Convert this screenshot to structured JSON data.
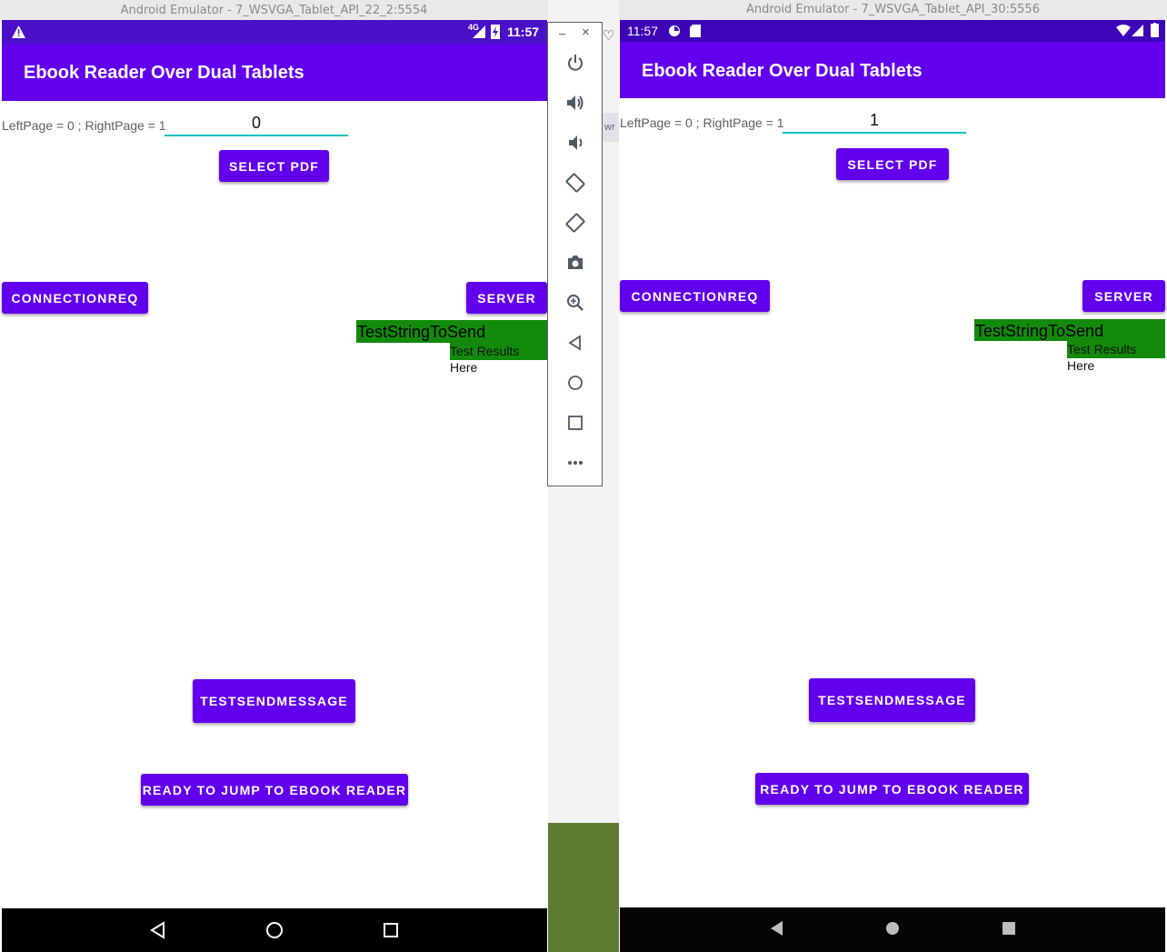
{
  "left_window": {
    "title": "Android Emulator - 7_WSVGA_Tablet_API_22_2:5554",
    "status_time": "11:57",
    "status_network": "4G",
    "app_title": "Ebook Reader Over Dual Tablets",
    "page_label": "LeftPage = 0 ; RightPage = 1",
    "page_input_value": "0",
    "select_pdf_label": "Select PDF",
    "connectionreq_label": "CONNECTIONREQ",
    "server_label": "SERVER",
    "test_string": "TestStringToSend",
    "test_results": "Test Results Here",
    "testsendmessage_label": "TESTSENDMESSAGE",
    "ready_label": "READY TO JUMP TO EBOOK READER"
  },
  "right_window": {
    "title": "Android Emulator - 7_WSVGA_Tablet_API_30:5556",
    "status_time": "11:57",
    "app_title": "Ebook Reader Over Dual Tablets",
    "page_label": "LeftPage = 0 ; RightPage = 1",
    "page_input_value": "1",
    "select_pdf_label": "Select PDF",
    "connectionreq_label": "CONNECTIONREQ",
    "server_label": "SERVER",
    "test_string": "TestStringToSend",
    "test_results": "Test Results Here",
    "testsendmessage_label": "TESTSENDMESSAGE",
    "ready_label": "READY TO JUMP TO EBOOK READER"
  },
  "toolbar": {
    "minimize": "–",
    "close": "×",
    "icons": [
      "power-icon",
      "volume-up-icon",
      "volume-down-icon",
      "rotate-left-icon",
      "rotate-right-icon",
      "camera-icon",
      "zoom-icon",
      "back-icon",
      "home-icon",
      "overview-icon",
      "more-icon"
    ]
  },
  "background_text": "wr",
  "colors": {
    "primary": "#6200ee",
    "status_bar": "#3e05b8",
    "accent": "#13c2c2",
    "test_green": "#138a0c"
  }
}
